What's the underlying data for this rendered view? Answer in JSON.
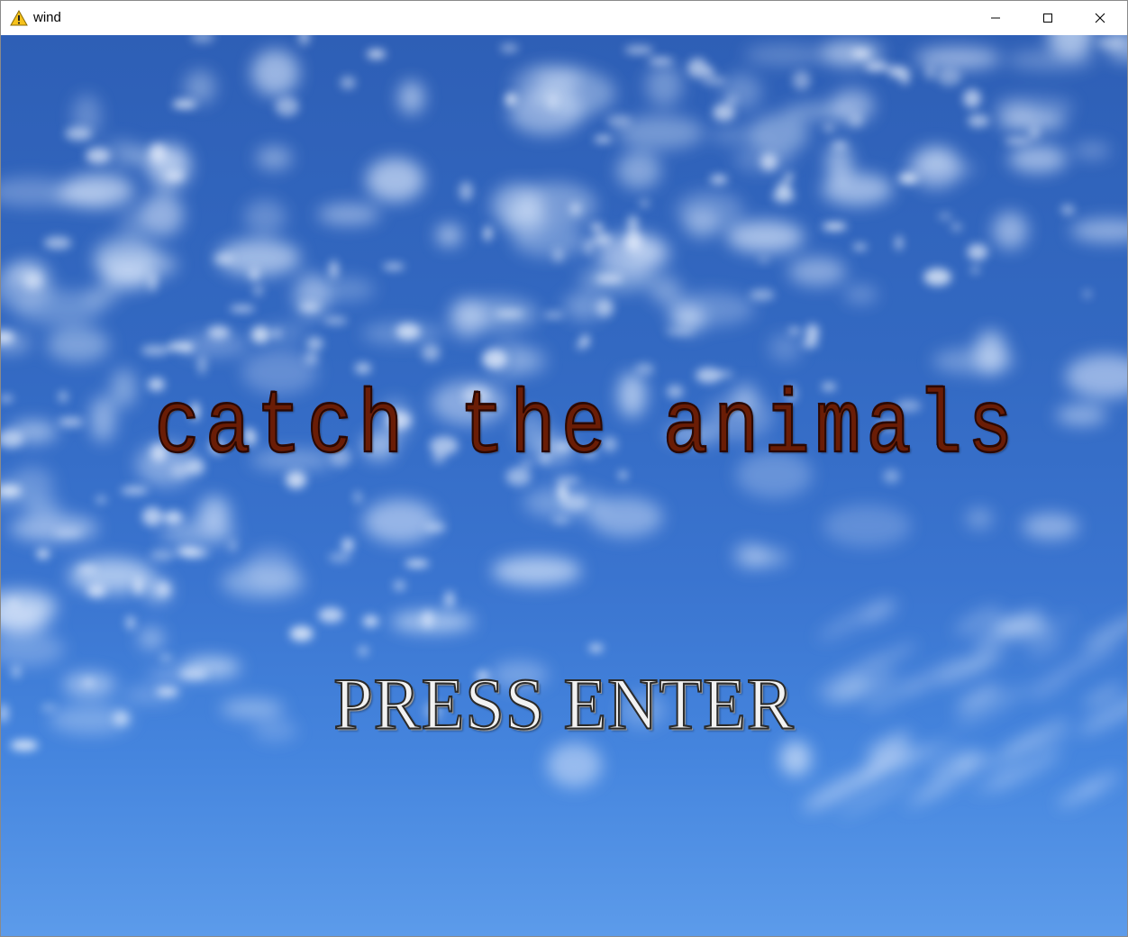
{
  "window": {
    "title": "wind",
    "icon": "warning-icon",
    "controls": [
      "minimize-icon",
      "maximize-icon",
      "close-icon"
    ]
  },
  "game": {
    "title": "catch the animals",
    "prompt": "PRESS ENTER",
    "background": "blue-sky-with-clouds"
  },
  "colors": {
    "sky_top": "#2e5fb6",
    "sky_bottom": "#5c9bea",
    "title_fill": "#6a1d06",
    "prompt_fill": "#f2f2f2"
  }
}
